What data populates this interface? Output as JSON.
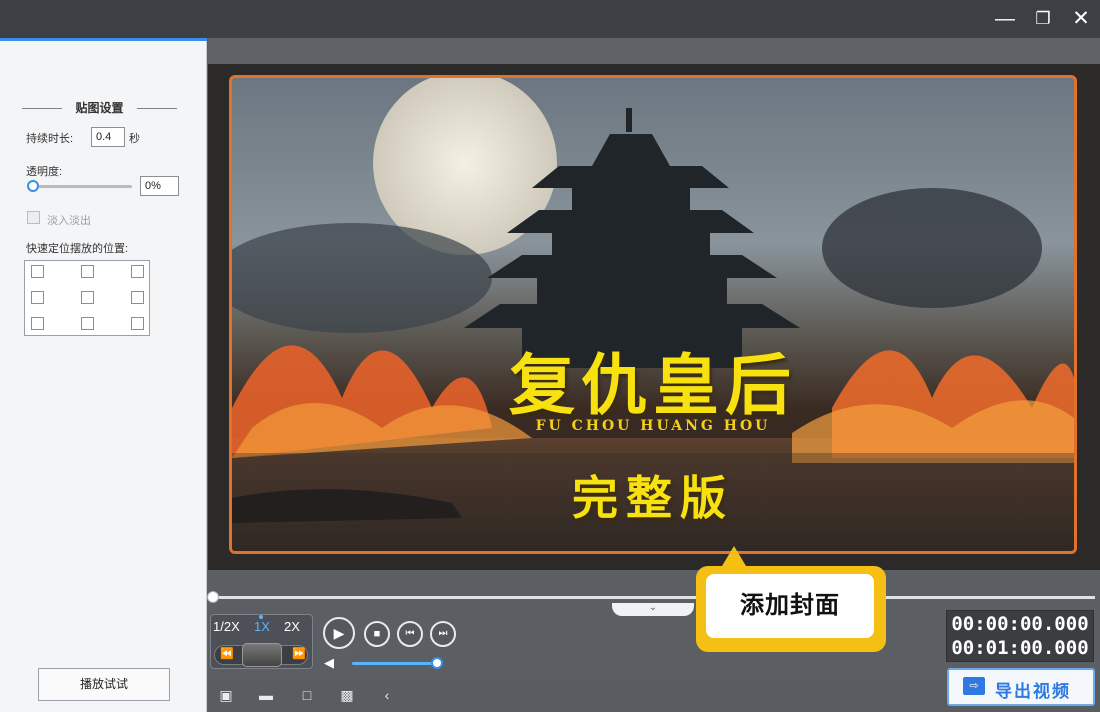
{
  "window": {
    "minimize_icon": "minimize-icon",
    "maximize_icon": "restore-icon",
    "close_icon": "close-icon",
    "min_glyph": "—",
    "max_glyph": "❐",
    "close_glyph": "✕"
  },
  "left_panel": {
    "section_title": "贴图设置",
    "duration_label": "持续时长:",
    "duration_value": "0.4",
    "duration_unit": "秒",
    "opacity_label": "透明度:",
    "opacity_value": "0%",
    "opacity_slider_fraction": 0.0,
    "fade_label": "淡入淡出",
    "fade_checked": false,
    "position_label": "快速定位摆放的位置:",
    "position_grid_checked": [
      false,
      false,
      false,
      false,
      false,
      false,
      false,
      false,
      false
    ],
    "trial_button": "播放试试"
  },
  "preview": {
    "title_cn": "复仇皇后",
    "subtitle_en": "FU CHOU HUANG HOU",
    "edition": "完整版"
  },
  "callout": {
    "text": "添加封面",
    "color": "#f6bf14"
  },
  "playback": {
    "progress_fraction": 0.0,
    "speed_options": [
      "1/2X",
      "1X",
      "2X"
    ],
    "speed_selected": "1X",
    "speed_prev_glyph": "⏪",
    "speed_next_glyph": "⏩",
    "play_glyph": "▶",
    "stop_glyph": "■",
    "prev_glyph": "⏮",
    "next_glyph": "⏭",
    "volume_glyph": "◀",
    "notch_glyph": "⌄",
    "volume_fraction": 1.0,
    "current_time": "00:00:00.000",
    "total_time": "00:01:00.000"
  },
  "toolbar": {
    "tools": [
      {
        "icon": "film-icon",
        "glyph": "▣"
      },
      {
        "icon": "open-folder-icon",
        "glyph": "▬"
      },
      {
        "icon": "save-icon",
        "glyph": "□"
      },
      {
        "icon": "save-as-icon",
        "glyph": "▩"
      },
      {
        "icon": "share-icon",
        "glyph": "‹"
      }
    ],
    "export_label": "导出视频",
    "export_glyph": "⇨"
  },
  "colors": {
    "accent": "#3a8ee6",
    "title_yellow": "#f7e10f",
    "frame_orange": "#e0732b"
  }
}
